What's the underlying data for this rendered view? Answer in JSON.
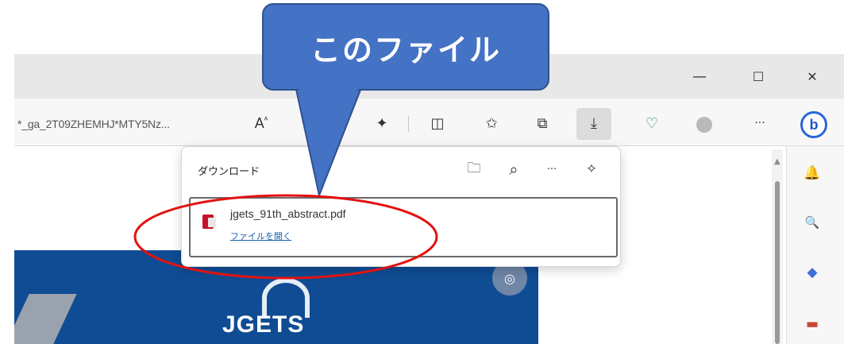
{
  "callout": {
    "text": "このファイル",
    "fill": "#4472C4",
    "border": "#2F528F"
  },
  "window_controls": {
    "minimize": "—",
    "maximize": "☐",
    "close": "✕"
  },
  "toolbar": {
    "address_text": "*_ga_2T09ZHEMHJ*MTY5Nz...",
    "read_aloud": "A",
    "read_aloud_sup": "ᴬ"
  },
  "icons": {
    "read_aloud": "read-aloud-icon",
    "favorite": "star-icon",
    "extensions": "puzzle-icon",
    "split_screen": "split-screen-icon",
    "favorites_list": "favorites-icon",
    "collections": "collections-icon",
    "downloads": "download-icon",
    "health": "browser-essentials-icon",
    "profile": "profile-icon",
    "more": "more-icon",
    "bing": "bing-copilot-icon"
  },
  "glyphs": {
    "star": "☆",
    "puzzle": "✦",
    "split": "◫",
    "favorites": "✩",
    "collections": "⧉",
    "download": "⤓",
    "health": "♡",
    "more": "···",
    "bing": "b",
    "folder": "🗀",
    "search": "⌕",
    "pin": "✧",
    "camera": "◎",
    "bell": "🔔",
    "zoom": "🔍",
    "tag": "◆",
    "toolbox": "▬",
    "scroll_up": "▲"
  },
  "downloads_panel": {
    "title": "ダウンロード",
    "item": {
      "file_name": "jgets_91th_abstract.pdf",
      "action": "ファイルを開く"
    }
  },
  "page": {
    "banner_text": "JGETS"
  },
  "colors": {
    "accent": "#2B67D8",
    "banner": "#0F4C93",
    "highlight_ring": "#E31212"
  }
}
